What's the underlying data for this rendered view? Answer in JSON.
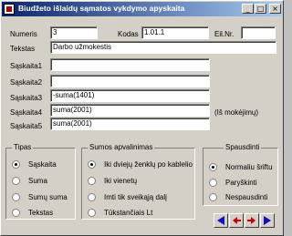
{
  "window": {
    "title": "Biudžeto išlaidų sąmatos vykdymo apyskaita"
  },
  "fields": {
    "numeris": {
      "label": "Numeris",
      "value": "3"
    },
    "kodas": {
      "label": "Kodas",
      "value": "1.01.1"
    },
    "eil_nr": {
      "label": "Eil.Nr.",
      "value": ""
    },
    "tekstas": {
      "label": "Tekstas",
      "value": "Darbo užmokestis"
    },
    "saskaita1": {
      "label": "Sąskaita1",
      "value": ""
    },
    "saskaita2": {
      "label": "Sąskaita2",
      "value": ""
    },
    "saskaita3": {
      "label": "Sąskaita3",
      "value": "-suma(1401)"
    },
    "saskaita4": {
      "label": "Sąskaita4",
      "value": "suma(2001)",
      "note": "(Iš mokėjimų)"
    },
    "saskaita5": {
      "label": "Sąskaita5",
      "value": "suma(2001)"
    }
  },
  "groups": {
    "tipas": {
      "title": "Tipas",
      "options": [
        "Sąskaita",
        "Suma",
        "Sumų suma",
        "Tekstas"
      ],
      "selected": 0
    },
    "sumos": {
      "title": "Sumos apvalinimas",
      "options": [
        "Iki dviejų ženklų po kablelio",
        "Iki vienetų",
        "Imti tik sveikąją dalį",
        "Tūkstančiais Lt"
      ],
      "selected": 0
    },
    "spausdinti": {
      "title": "Spausdinti",
      "options": [
        "Normaliu šriftu",
        "Paryškinti",
        "Nespausdinti"
      ],
      "selected": 0
    }
  },
  "titlebar_buttons": {
    "minimize": "_",
    "maximize": "□",
    "close": "×"
  },
  "icons": {
    "nav": [
      "first-arrow-icon",
      "prev-arrow-icon",
      "next-arrow-icon",
      "last-arrow-icon"
    ]
  },
  "colors": {
    "title_start": "#0a246a",
    "title_end": "#a6caf0",
    "nav_blue": "#1010c0",
    "nav_red": "#c00000"
  }
}
